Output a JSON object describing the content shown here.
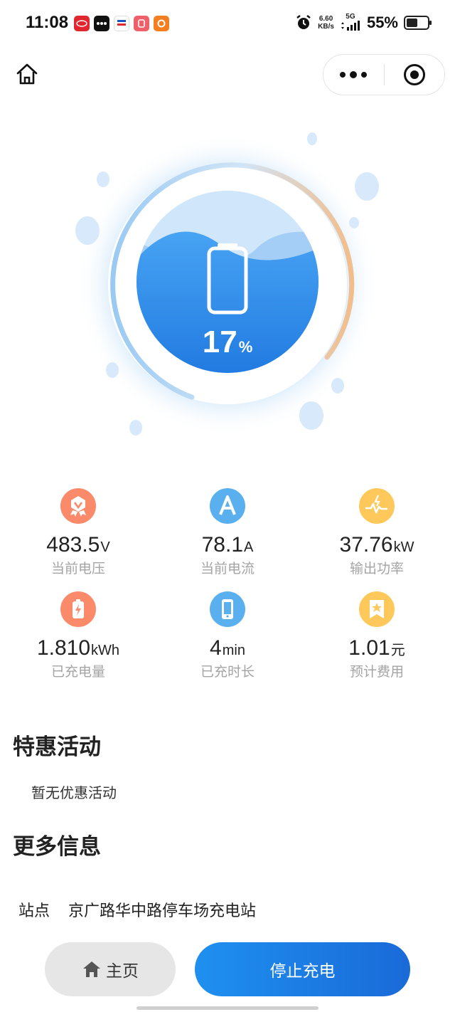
{
  "status_bar": {
    "time": "11:08",
    "net_speed": "6.60",
    "net_unit": "KB/s",
    "network": "5G",
    "battery_percent": "55%",
    "battery_level": 0.55,
    "app_icons": [
      "app-icon-evo",
      "app-icon-dots",
      "app-icon-news",
      "app-icon-red",
      "app-icon-orange"
    ]
  },
  "nav": {
    "home_icon": "home-icon",
    "more_icon": "more-dots-icon",
    "close_icon": "target-close-icon"
  },
  "charging": {
    "percent": "17",
    "percent_unit": "%",
    "level": 0.17
  },
  "stats": [
    {
      "icon": "voltage-badge-icon",
      "color": "#fa8a6a",
      "value": "483.5",
      "unit": "V",
      "label": "当前电压"
    },
    {
      "icon": "ampere-icon",
      "color": "#5aafef",
      "value": "78.1",
      "unit": "A",
      "label": "当前电流"
    },
    {
      "icon": "power-wave-icon",
      "color": "#ffc85a",
      "value": "37.76",
      "unit": "kW",
      "label": "输出功率"
    },
    {
      "icon": "battery-charge-icon",
      "color": "#fa8a6a",
      "value": "1.810",
      "unit": "kWh",
      "label": "已充电量"
    },
    {
      "icon": "phone-time-icon",
      "color": "#5aafef",
      "value": "4",
      "unit": "min",
      "label": "已充时长"
    },
    {
      "icon": "bookmark-star-icon",
      "color": "#ffc85a",
      "value": "1.01",
      "unit": "元",
      "label": "预计费用"
    }
  ],
  "promotions": {
    "title": "特惠活动",
    "empty_text": "暂无优惠活动"
  },
  "more_info": {
    "title": "更多信息",
    "station_label": "站点",
    "station_value": "京广路华中路停车场充电站"
  },
  "actions": {
    "home_label": "主页",
    "stop_label": "停止充电"
  }
}
